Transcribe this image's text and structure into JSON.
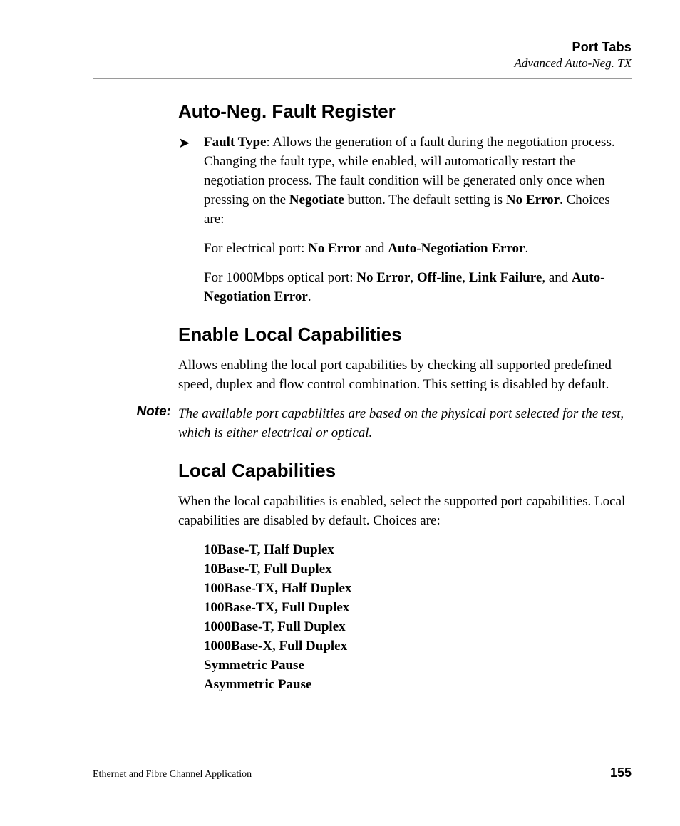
{
  "header": {
    "chapter": "Port Tabs",
    "section": "Advanced Auto-Neg. TX"
  },
  "s1": {
    "heading": "Auto-Neg. Fault Register",
    "bullet_label": "Fault Type",
    "bullet_rest": ": Allows the generation of a fault during the negotiation process. Changing the fault type, while enabled, will automatically restart the negotiation process. The fault condition will be generated only once when pressing on the ",
    "bullet_negotiate": "Negotiate",
    "bullet_rest2": " button. The default setting is ",
    "bullet_noerror": "No Error",
    "bullet_rest3": ". Choices are:",
    "elec_pre": "For electrical port: ",
    "elec_noerror": "No Error",
    "elec_and": " and ",
    "elec_ane": "Auto-Negotiation Error",
    "elec_post": ".",
    "opt_pre": "For 1000Mbps optical port: ",
    "opt_noerror": "No Error",
    "opt_c1": ", ",
    "opt_offline": "Off-line",
    "opt_c2": ", ",
    "opt_linkfail": "Link Failure",
    "opt_c3": ", and ",
    "opt_ane": "Auto-Negotiation Error",
    "opt_post": "."
  },
  "s2": {
    "heading": "Enable Local Capabilities",
    "para": "Allows enabling the local port capabilities by checking all supported predefined speed, duplex and flow control combination. This setting is disabled by default."
  },
  "note": {
    "label": "Note:",
    "text": "The available port capabilities are based on the physical port selected for the test, which is either electrical or optical."
  },
  "s3": {
    "heading": "Local Capabilities",
    "para": "When the local capabilities is enabled, select the supported port capabilities. Local capabilities are disabled by default. Choices are:",
    "caps": {
      "c0": "10Base-T, Half Duplex",
      "c1": "10Base-T, Full Duplex",
      "c2": "100Base-TX, Half Duplex",
      "c3": "100Base-TX, Full Duplex",
      "c4": "1000Base-T, Full Duplex",
      "c5": "1000Base-X, Full Duplex",
      "c6": "Symmetric Pause",
      "c7": "Asymmetric Pause"
    }
  },
  "footer": {
    "app": "Ethernet and Fibre Channel Application",
    "page": "155"
  }
}
